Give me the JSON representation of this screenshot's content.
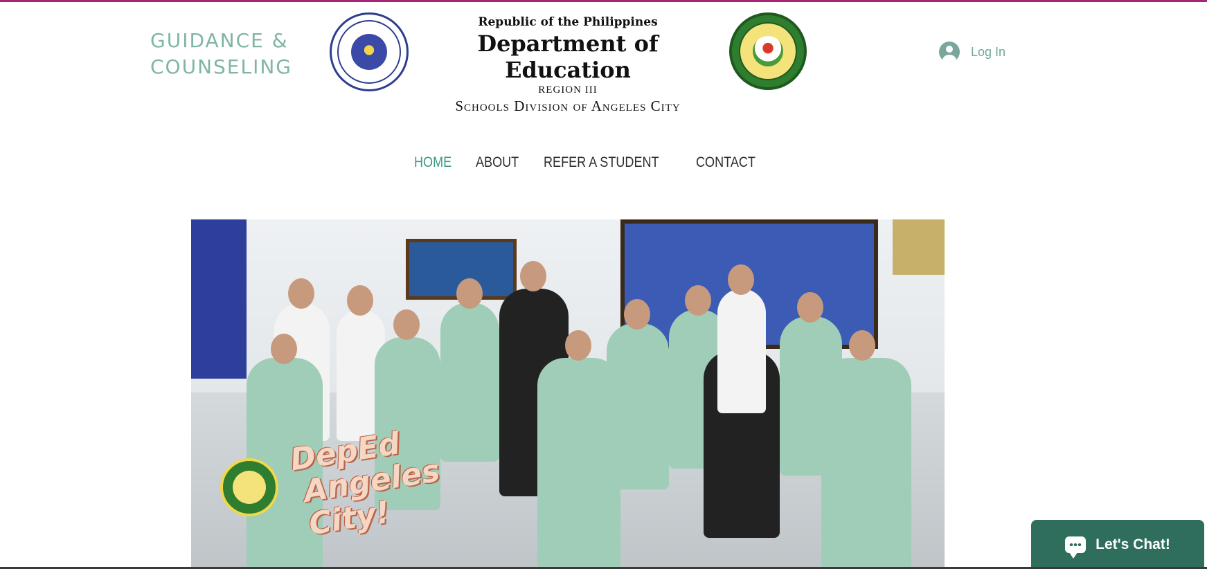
{
  "site": {
    "title_line1": "GUIDANCE &",
    "title_line2": "COUNSELING"
  },
  "deped": {
    "republic": "Republic of the Philippines",
    "department": "Department of Education",
    "region": "Region III",
    "division": "Schools Division of Angeles City"
  },
  "account": {
    "login_label": "Log In"
  },
  "nav": {
    "items": [
      {
        "label": "HOME",
        "active": true
      },
      {
        "label": "ABOUT",
        "active": false
      },
      {
        "label": "REFER A STUDENT",
        "active": false
      },
      {
        "label": "CONTACT",
        "active": false
      }
    ]
  },
  "hero": {
    "caption_line1": "DepEd",
    "caption_line2": "Angeles City!"
  },
  "chat": {
    "label": "Let's Chat!"
  },
  "icons": {
    "login": "user-avatar-icon",
    "chat": "chat-bubble-icon"
  },
  "colors": {
    "accent": "#3a9a86",
    "title": "#7fb5a6",
    "top_strip": "#a6247a",
    "chat_bg": "#2f6e5c"
  }
}
